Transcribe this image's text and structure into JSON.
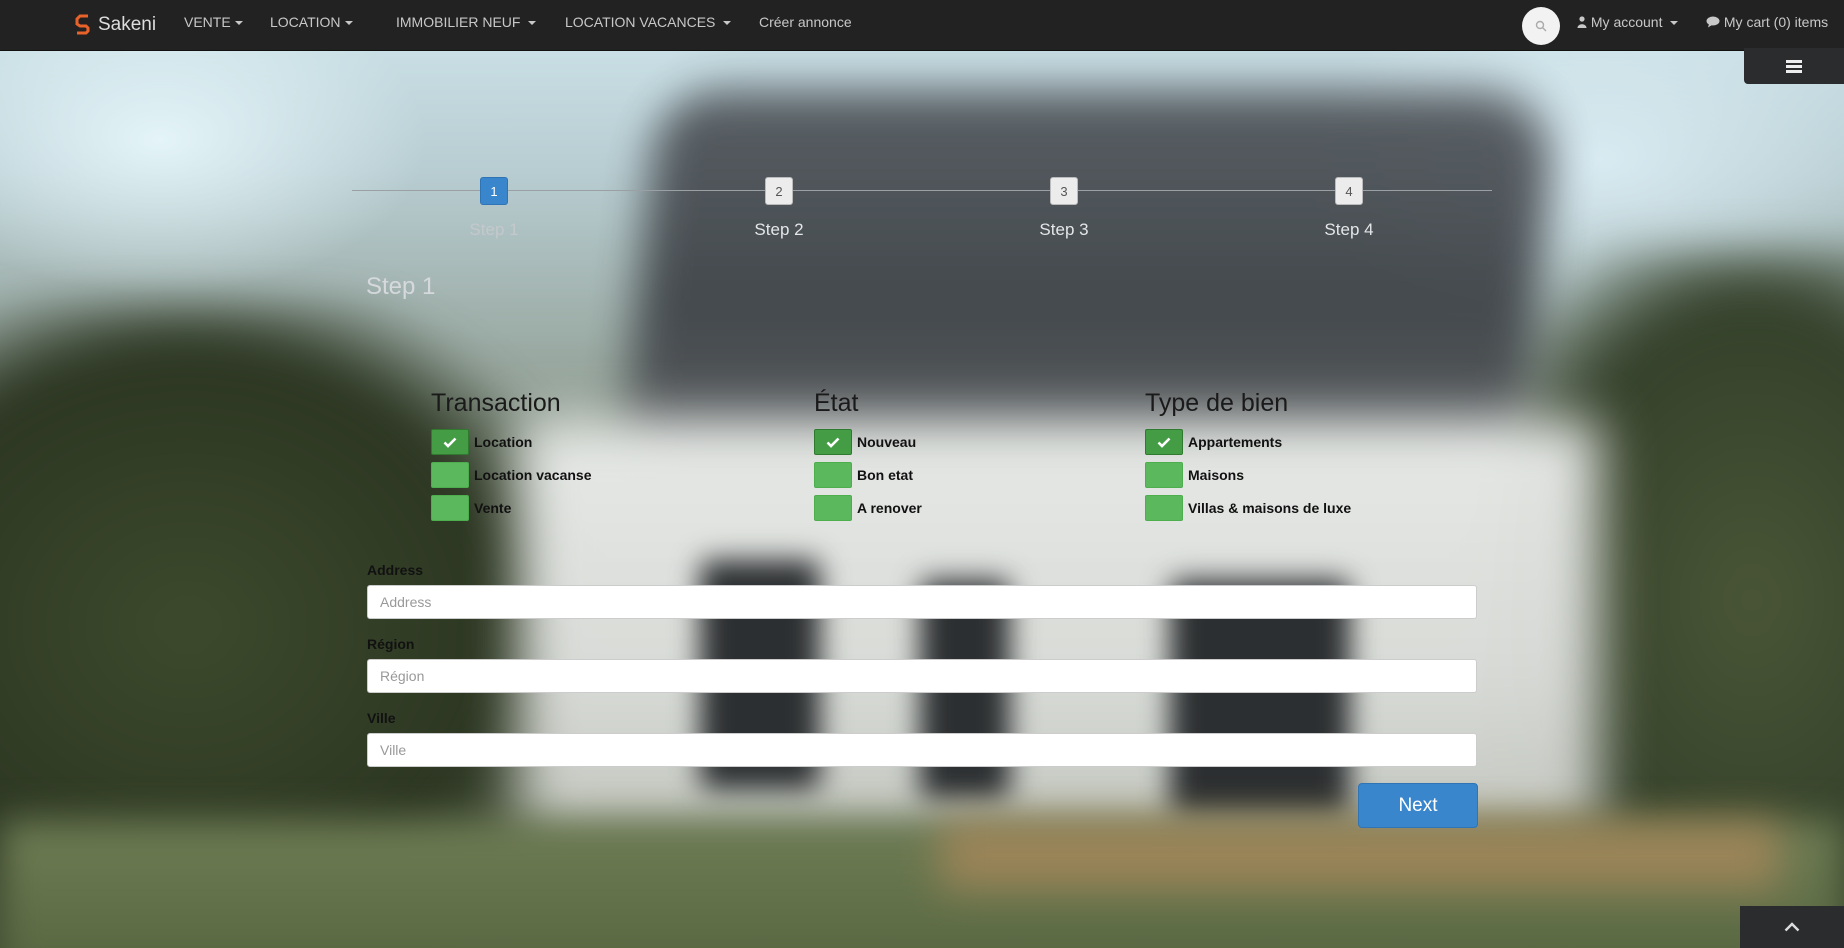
{
  "brand": {
    "name": "Sakeni"
  },
  "nav": {
    "vente": "VENTE",
    "location": "LOCATION",
    "immobilier_neuf": "IMMOBILIER NEUF",
    "location_vacances": "LOCATION VACANCES",
    "creer_annonce": "Créer annonce",
    "my_account": "My account",
    "my_cart": "My cart (0) items"
  },
  "stepper": {
    "steps": [
      {
        "number": "1",
        "label": "Step 1",
        "active": true
      },
      {
        "number": "2",
        "label": "Step 2",
        "active": false
      },
      {
        "number": "3",
        "label": "Step 3",
        "active": false
      },
      {
        "number": "4",
        "label": "Step 4",
        "active": false
      }
    ],
    "current_title": "Step 1"
  },
  "groups": {
    "transaction": {
      "title": "Transaction",
      "options": [
        {
          "label": "Location",
          "checked": true
        },
        {
          "label": "Location vacanse",
          "checked": false
        },
        {
          "label": "Vente",
          "checked": false
        }
      ]
    },
    "etat": {
      "title": "État",
      "options": [
        {
          "label": "Nouveau",
          "checked": true
        },
        {
          "label": "Bon etat",
          "checked": false
        },
        {
          "label": "A renover",
          "checked": false
        }
      ]
    },
    "type_de_bien": {
      "title": "Type de bien",
      "options": [
        {
          "label": "Appartements",
          "checked": true
        },
        {
          "label": "Maisons",
          "checked": false
        },
        {
          "label": "Villas & maisons de luxe",
          "checked": false
        }
      ]
    }
  },
  "form": {
    "address": {
      "label": "Address",
      "placeholder": "Address",
      "value": ""
    },
    "region": {
      "label": "Région",
      "placeholder": "Région",
      "value": ""
    },
    "ville": {
      "label": "Ville",
      "placeholder": "Ville",
      "value": ""
    }
  },
  "actions": {
    "next": "Next"
  },
  "colors": {
    "navbar": "#222222",
    "primary": "#3a86cc",
    "checkbox_green": "#5cb85c"
  },
  "icons": {
    "search": "search-icon",
    "user": "user-icon",
    "cart": "comment-icon",
    "menu": "hamburger-icon",
    "check": "check-icon",
    "back_to_top": "chevron-up-icon"
  }
}
